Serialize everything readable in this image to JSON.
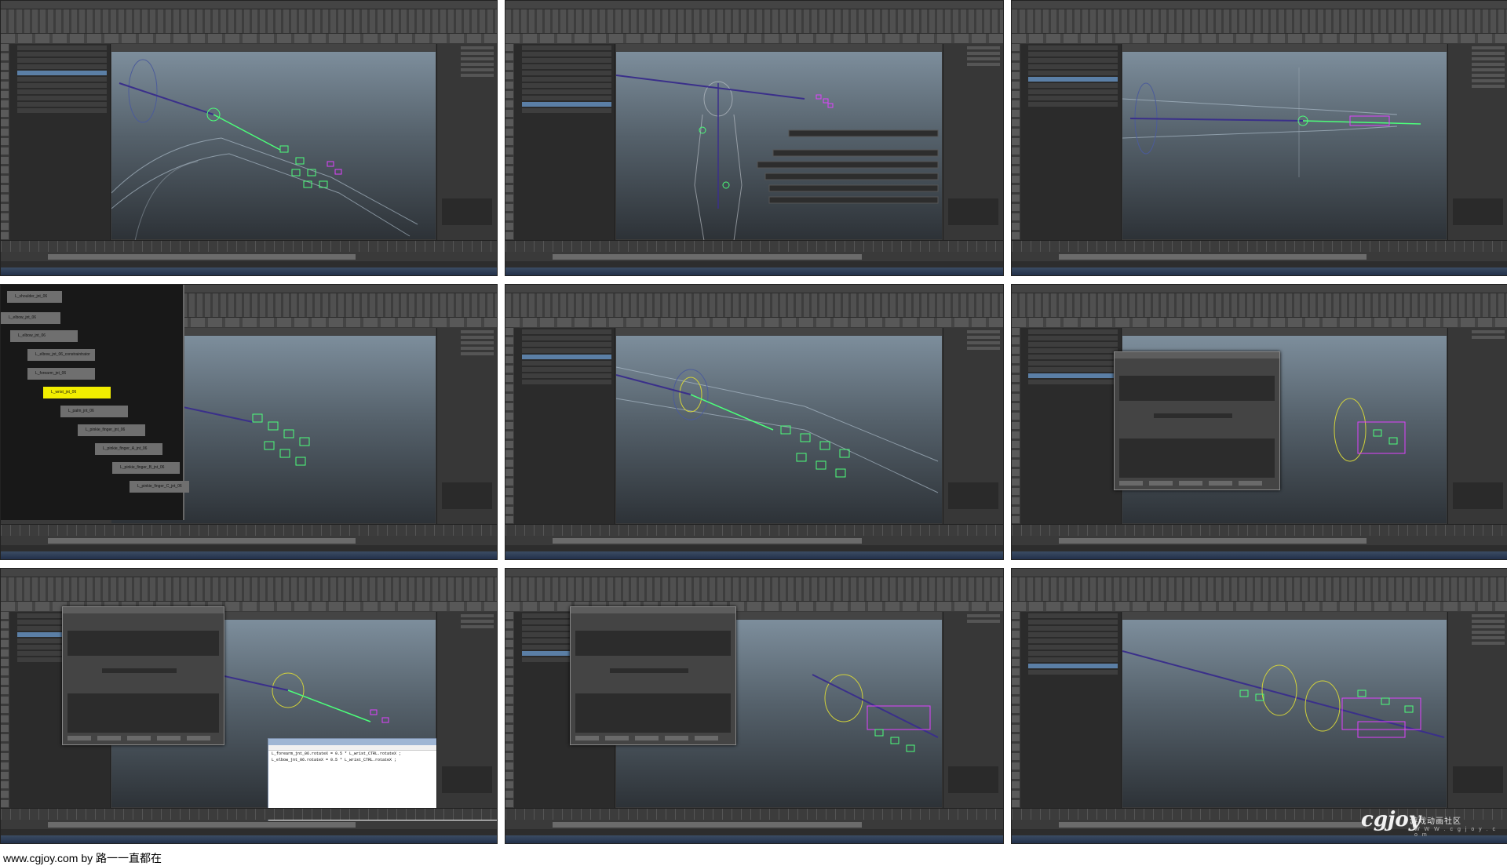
{
  "footer": {
    "text": "www.cgjoy.com by 路一一直都在"
  },
  "watermark": {
    "logo": "cgjoy",
    "subtitle": "游戏动画社区",
    "url": "W W W . c g j o y . c o m"
  },
  "hierarchy": {
    "nodes": [
      "L_shoulder_jnt_06",
      "L_elbow_jnt_06",
      "L_elbow_jnt_06_constraintrator",
      "L_forearm_jnt_06",
      "L_wrist_jnt_06",
      "L_palm_jnt_06",
      "L_pinkie_finger_jnt_06",
      "L_pinkie_finger_A_jnt_06",
      "L_pinkie_finger_B_jnt_06",
      "L_pinkie_finger_C_jnt_06"
    ],
    "highlighted_index": 4
  },
  "notepad": {
    "lines": [
      "L_forearm_jnt_06.rotateX = 0.5 * L_wrist_CTRL.rotateX ;",
      "L_elbow_jnt_06.rotateX = 0.5 * L_wrist_CTRL.rotateX ;"
    ]
  },
  "colors": {
    "ui_bg": "#3a3a3a",
    "viewport_top": "#7d8e9c",
    "viewport_bottom": "#2d3237",
    "joint_green": "#4cff7a",
    "joint_magenta": "#e040ff",
    "highlight_yellow": "#f2ee00"
  },
  "icons": [
    "joint-icon",
    "camera-icon",
    "move-tool-icon",
    "rotate-tool-icon",
    "scale-tool-icon"
  ]
}
